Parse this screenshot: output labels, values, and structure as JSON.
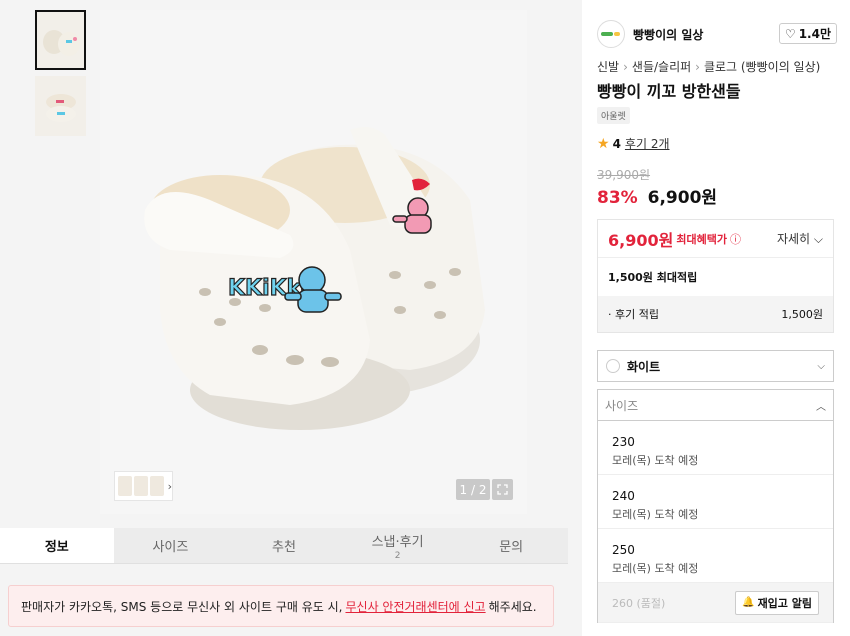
{
  "gallery": {
    "pager": "1 / 2",
    "expand_icon": "expand-icon"
  },
  "tabs": [
    {
      "label": "정보",
      "sub": ""
    },
    {
      "label": "사이즈",
      "sub": ""
    },
    {
      "label": "추천",
      "sub": ""
    },
    {
      "label": "스냅·후기",
      "sub": "2"
    },
    {
      "label": "문의",
      "sub": ""
    }
  ],
  "warning": {
    "pre": "판매자가 카카오톡, SMS 등으로 무신사 외 사이트 구매 유도 시,",
    "link": "무신사 안전거래센터에 신고",
    "post": "해주세요."
  },
  "shop": {
    "name": "빵빵이의 일상",
    "likes": "1.4만"
  },
  "breadcrumb": [
    "신발",
    "샌들/슬리퍼",
    "클로그 (빵빵이의 일상)"
  ],
  "product": {
    "title": "빵빵이 끼꼬 방한샌들",
    "tag": "아울렛",
    "rating": "4",
    "reviews": "후기 2개",
    "original_price": "39,900원",
    "discount": "83%",
    "price": "6,900원"
  },
  "benefit": {
    "max_price": "6,900원",
    "max_label": "최대혜택가",
    "detail": "자세히",
    "points_total": "1,500원 최대적립",
    "review_label": "· 후기 적립",
    "review_amount": "1,500원"
  },
  "options": {
    "color": "화이트",
    "size_placeholder": "사이즈",
    "sizes": [
      {
        "size": "230",
        "status": "모레(목) 도착 예정"
      },
      {
        "size": "240",
        "status": "모레(목) 도착 예정"
      },
      {
        "size": "250",
        "status": "모레(목) 도착 예정"
      }
    ],
    "soldout": {
      "size": "260 (품절)",
      "button": "재입고 알림"
    }
  }
}
